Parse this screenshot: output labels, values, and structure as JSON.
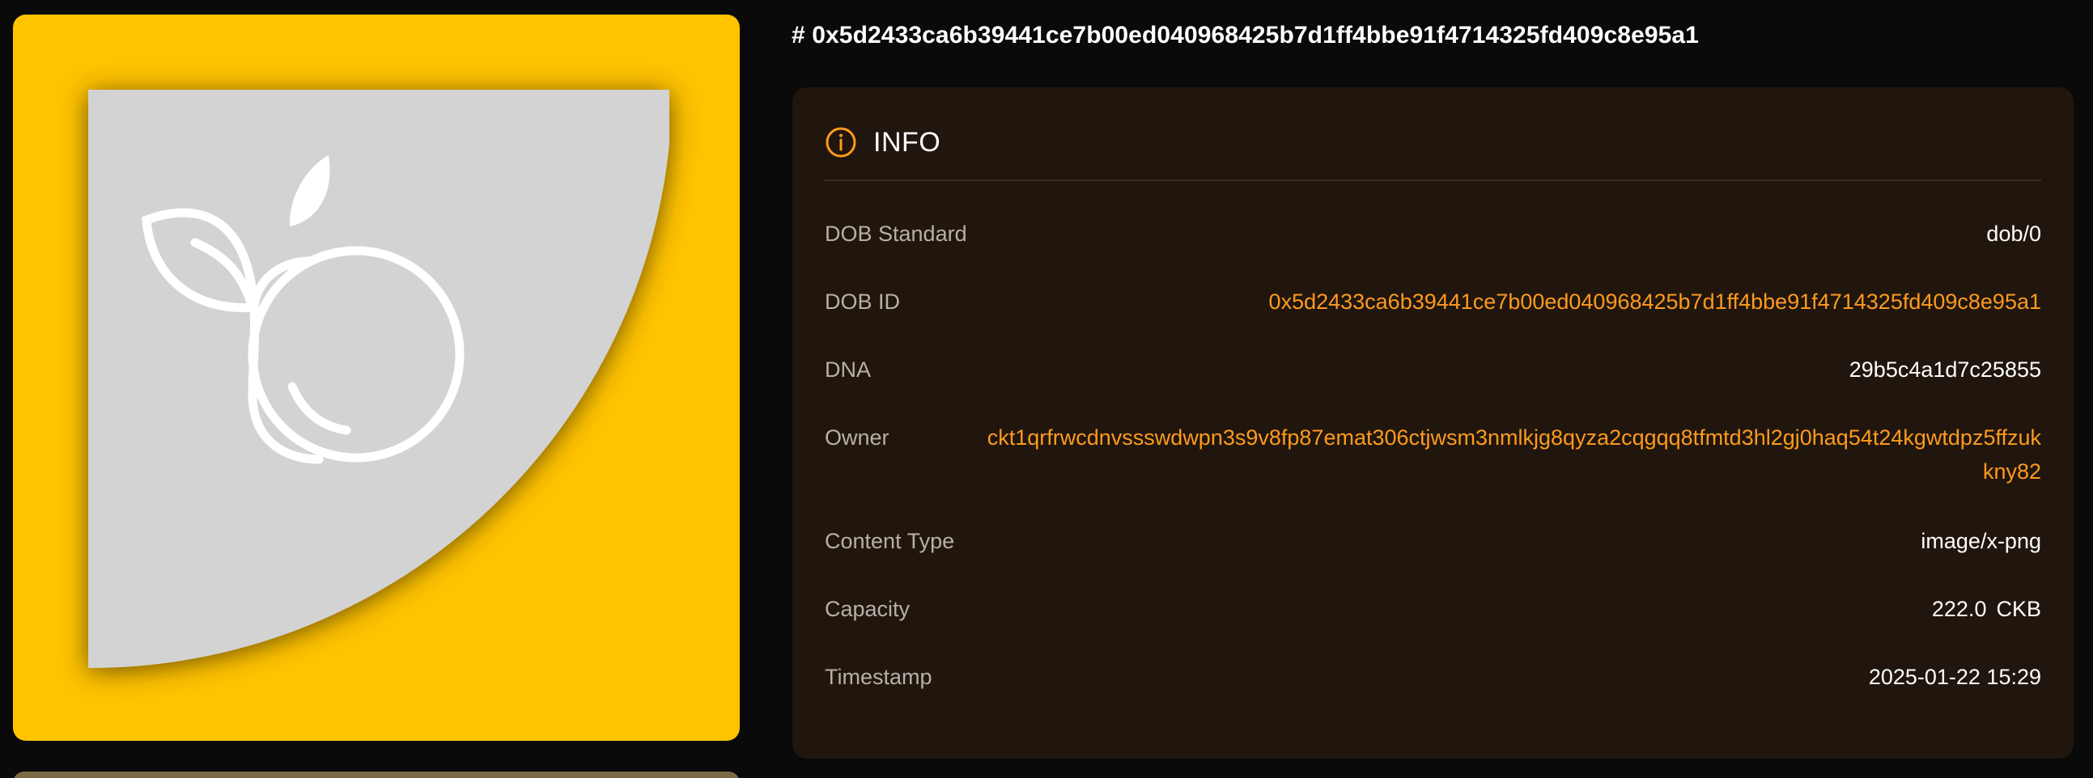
{
  "title": "# 0x5d2433ca6b39441ce7b00ed040968425b7d1ff4bbe91f4714325fd409c8e95a1",
  "info": {
    "heading": "INFO",
    "icon": "info-circle-icon",
    "rows": {
      "dob_standard": {
        "label": "DOB Standard",
        "value": "dob/0"
      },
      "dob_id": {
        "label": "DOB ID",
        "value": "0x5d2433ca6b39441ce7b00ed040968425b7d1ff4bbe91f4714325fd409c8e95a1"
      },
      "dna": {
        "label": "DNA",
        "value": "29b5c4a1d7c25855"
      },
      "owner": {
        "label": "Owner",
        "value": "ckt1qrfrwcdnvssswdwpn3s9v8fp87emat306ctjwsm3nmlkjg8qyza2cqgqq8tfmtd3hl2gj0haq54t24kgwtdpz5ffzukkny82"
      },
      "content_type": {
        "label": "Content Type",
        "value": "image/x-png"
      },
      "capacity": {
        "label": "Capacity",
        "value": "222.0",
        "unit": "CKB"
      },
      "timestamp": {
        "label": "Timestamp",
        "value": "2025-01-22 15:29"
      }
    }
  },
  "artwork": {
    "background_color": "#ffc300",
    "shape_color": "#d3d3d3",
    "icon": "fruit-logo-icon"
  },
  "colors": {
    "accent": "#ff9a1f",
    "panel": "#20160d",
    "page": "#0a0a0a"
  }
}
